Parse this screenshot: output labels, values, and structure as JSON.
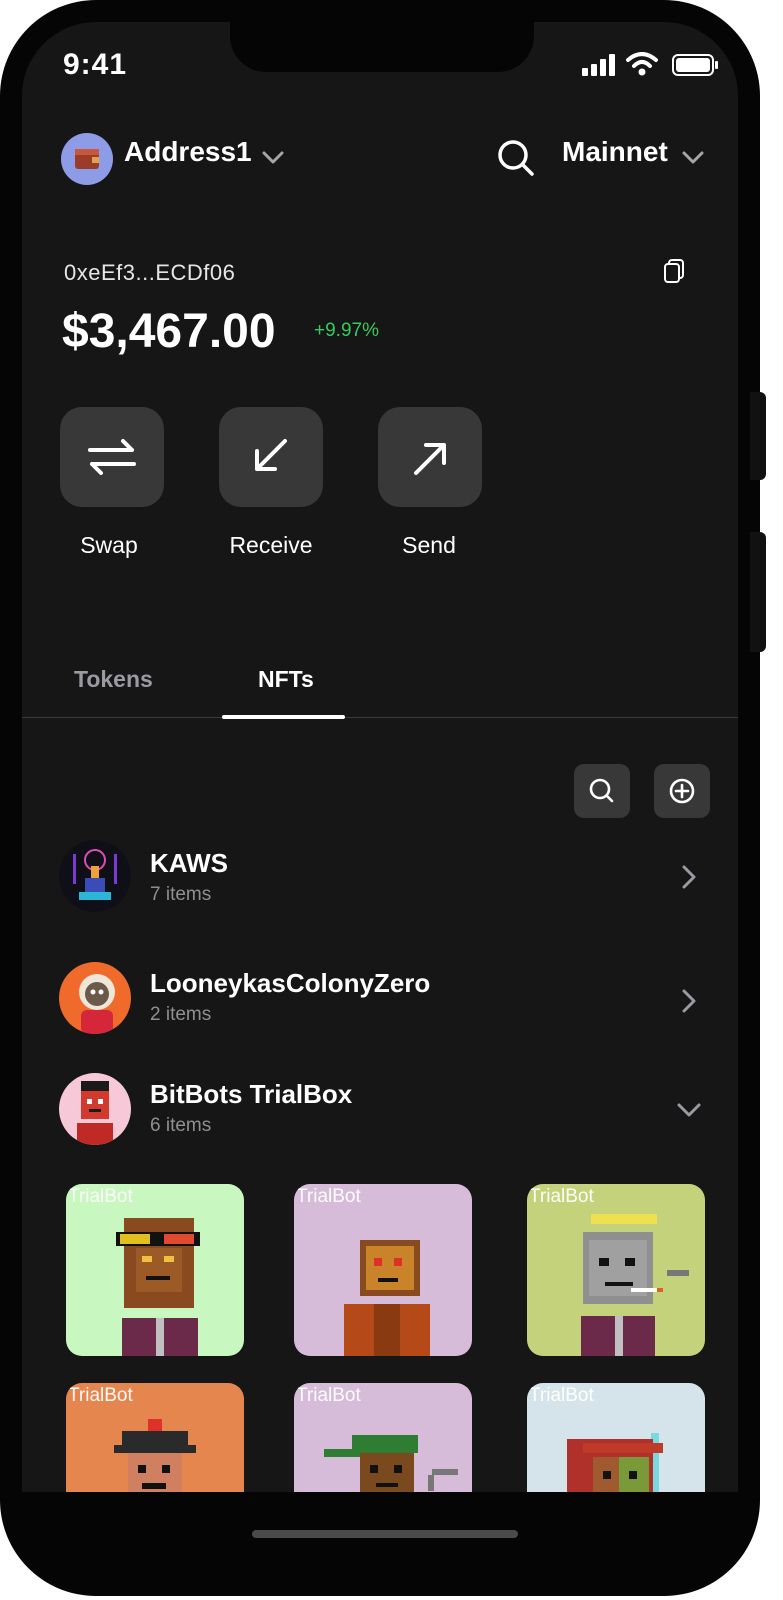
{
  "status_bar": {
    "time": "9:41",
    "icons": [
      "signal-icon",
      "wifi-icon",
      "battery-icon"
    ]
  },
  "header": {
    "wallet_name": "Address1",
    "network": "Mainnet",
    "icons": [
      "wallet-icon",
      "chevron-down-icon",
      "search-icon"
    ]
  },
  "account": {
    "address": "0xeEf3...ECDf06",
    "balance": "$3,467.00",
    "change": "+9.97%",
    "change_color": "#37c95b"
  },
  "actions": [
    {
      "label": "Swap",
      "icon": "swap-icon"
    },
    {
      "label": "Receive",
      "icon": "arrow-down-left-icon"
    },
    {
      "label": "Send",
      "icon": "arrow-up-right-icon"
    }
  ],
  "tabs": [
    {
      "label": "Tokens",
      "active": false
    },
    {
      "label": "NFTs",
      "active": true
    }
  ],
  "collections": [
    {
      "name": "KAWS",
      "count": "7 items",
      "expanded": false
    },
    {
      "name": "LooneykasColonyZero",
      "count": "2 items",
      "expanded": false
    },
    {
      "name": "BitBots TrialBox",
      "count": "6 items",
      "expanded": true
    }
  ],
  "nfts": [
    {
      "label": "TrialBot",
      "bg": "#c9f7c0"
    },
    {
      "label": "TrialBot",
      "bg": "#d6bcd8"
    },
    {
      "label": "TrialBot",
      "bg": "#c4d27c"
    },
    {
      "label": "TrialBot",
      "bg": "#e5864e"
    },
    {
      "label": "TrialBot",
      "bg": "#d6bcd8"
    },
    {
      "label": "TrialBot",
      "bg": "#d5e4ea"
    }
  ]
}
